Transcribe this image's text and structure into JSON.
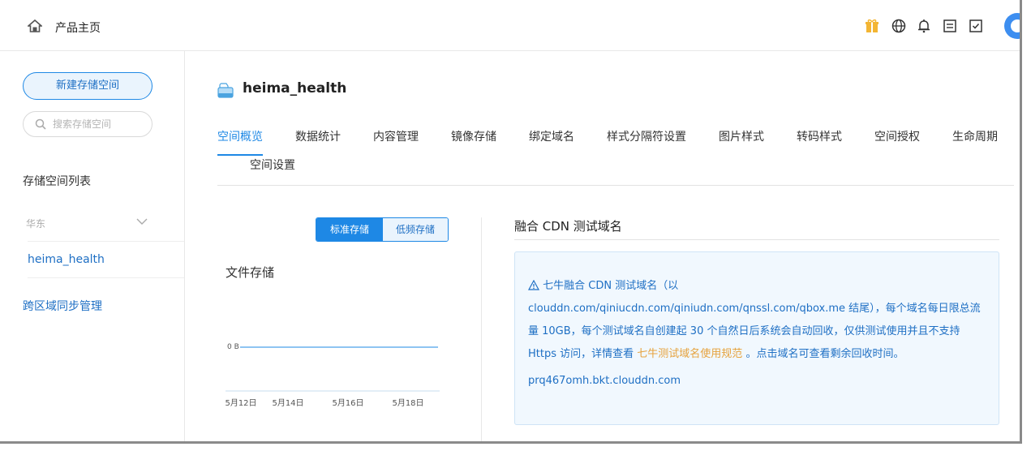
{
  "header": {
    "home_label": "产品主页",
    "icons": [
      "gift-icon",
      "globe-icon",
      "bell-icon",
      "document-icon",
      "task-icon",
      "avatar"
    ]
  },
  "sidebar": {
    "new_bucket_label": "新建存储空间",
    "search_placeholder": "搜索存储空间",
    "list_title": "存储空间列表",
    "region": "华东",
    "bucket": "heima_health",
    "cross_region_label": "跨区域同步管理"
  },
  "main": {
    "bucket_name": "heima_health",
    "tabs": [
      "空间概览",
      "数据统计",
      "内容管理",
      "镜像存储",
      "绑定域名",
      "样式分隔符设置",
      "图片样式",
      "转码样式",
      "空间授权",
      "生命周期",
      "空间设置"
    ],
    "active_tab": "空间概览"
  },
  "storage": {
    "segment_standard": "标准存储",
    "segment_low": "低频存储",
    "active_segment": "标准存储",
    "chart_title": "文件存储"
  },
  "chart_data": {
    "type": "line",
    "x_ticks": [
      "5月12日",
      "5月14日",
      "5月16日",
      "5月18日"
    ],
    "y_ticks": [
      "0 B"
    ],
    "series": [
      {
        "values": [
          0,
          0,
          0,
          0,
          0,
          0,
          0,
          0
        ]
      }
    ],
    "colors": {
      "line": "#1e88e5"
    }
  },
  "cdn": {
    "title": "融合 CDN 测试域名",
    "notice_prefix": "七牛融合 CDN 测试域名（以 clouddn.com/qiniucdn.com/qiniudn.com/qnssl.com/qbox.me 结尾），每个域名每日限总流量 10GB，每个测试域名自创建起 30 个自然日后系统会自动回收，仅供测试使用并且不支持 Https 访问，详情查看",
    "notice_link": "七牛测试域名使用规范",
    "notice_suffix": "。点击域名可查看剩余回收时间。",
    "test_domain": "prq467omh.bkt.clouddn.com"
  },
  "colors": {
    "accent": "#1e88e5",
    "link_orange": "#e6a23c",
    "notice_bg": "#f1f8fe"
  }
}
